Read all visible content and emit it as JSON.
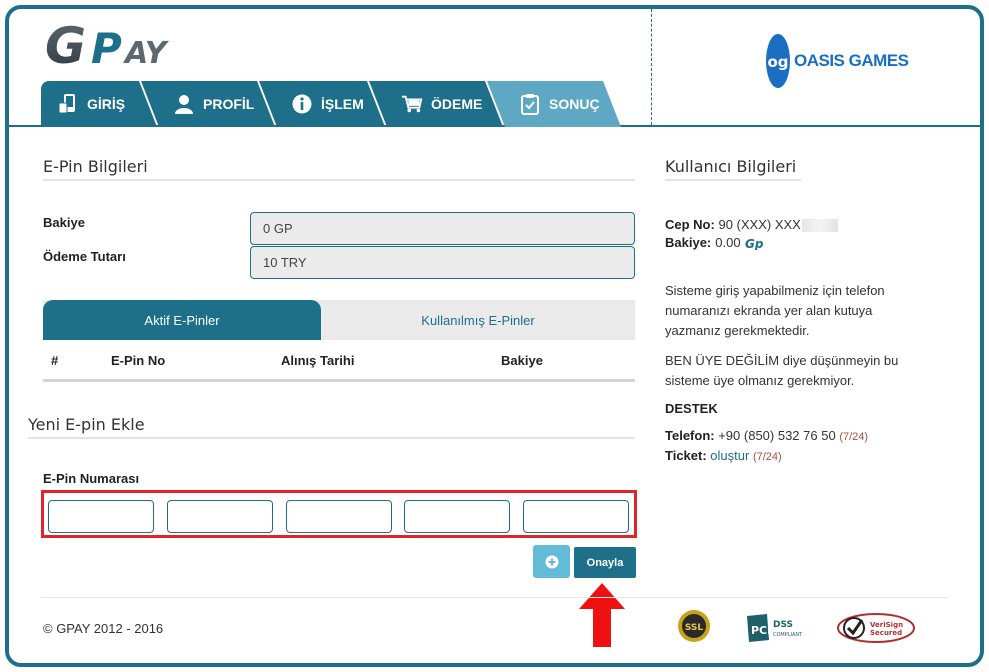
{
  "header": {
    "logo_text": "GPAY",
    "partner_logo": "OASIS GAMES",
    "tabs": [
      {
        "label": "GİRİŞ",
        "icon": "phone-card-icon"
      },
      {
        "label": "PROFİL",
        "icon": "user-icon"
      },
      {
        "label": "İŞLEM",
        "icon": "info-icon"
      },
      {
        "label": "ÖDEME",
        "icon": "cart-icon"
      },
      {
        "label": "SONUÇ",
        "icon": "clipboard-check-icon"
      }
    ],
    "active_tab": "SONUÇ"
  },
  "epin_info": {
    "title": "E-Pin Bilgileri",
    "balance_label": "Bakiye",
    "balance_value": "0 GP",
    "amount_label": "Ödeme Tutarı",
    "amount_value": "10 TRY"
  },
  "epin_tabs": {
    "active": "Aktif E-Pinler",
    "inactive": "Kullanılmış E-Pinler"
  },
  "table": {
    "columns": [
      "#",
      "E-Pin No",
      "Alınış Tarihi",
      "Bakiye"
    ],
    "rows": []
  },
  "add_epin": {
    "title": "Yeni E-pin Ekle",
    "field_label": "E-Pin Numarası",
    "inputs": [
      "",
      "",
      "",
      "",
      ""
    ],
    "confirm_label": "Onayla",
    "plus_icon": "plus-circle-icon"
  },
  "user_info": {
    "title": "Kullanıcı Bilgileri",
    "phone_label": "Cep No:",
    "phone_value": "90 (XXX) XXX",
    "balance_label": "Bakiye:",
    "balance_value": "0.00",
    "note1": "Sisteme giriş yapabilmeniz için telefon numaranızı ekranda yer alan kutuya yazmanız gerekmektedir.",
    "note2": "BEN ÜYE DEĞİLİM diye düşünmeyin bu sisteme üye olmanız gerekmiyor.",
    "support_title": "DESTEK",
    "tel_label": "Telefon:",
    "tel_value": "+90 (850) 532 76 50",
    "tel_hours": "(7/24)",
    "ticket_label": "Ticket:",
    "ticket_link": "oluştur",
    "ticket_hours": "(7/24)"
  },
  "footer": {
    "copyright": "© GPAY 2012 - 2016",
    "badges": [
      "SSL",
      "PCI DSS",
      "VeriSign Secured"
    ]
  },
  "colors": {
    "primary": "#1e6f8a",
    "active_tab": "#5ea8c3",
    "highlight": "#e0242b",
    "plus_button": "#62bcd8"
  }
}
